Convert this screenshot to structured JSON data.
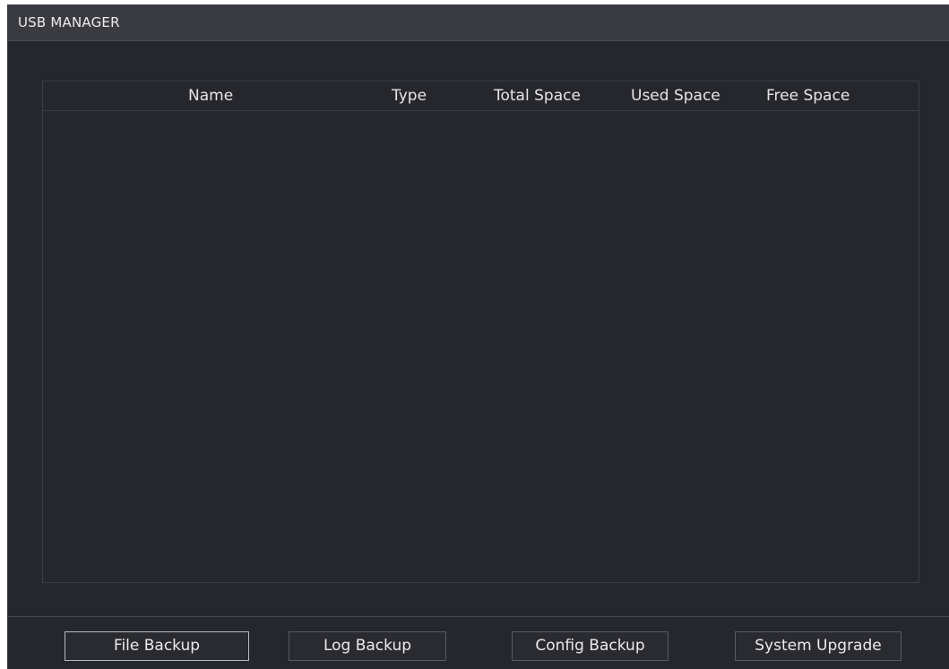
{
  "window": {
    "title": "USB MANAGER"
  },
  "table": {
    "columns": [
      "Name",
      "Type",
      "Total Space",
      "Used Space",
      "Free Space"
    ],
    "rows": []
  },
  "actions": {
    "file_backup": "File Backup",
    "log_backup": "Log Backup",
    "config_backup": "Config Backup",
    "system_upgrade": "System Upgrade"
  }
}
